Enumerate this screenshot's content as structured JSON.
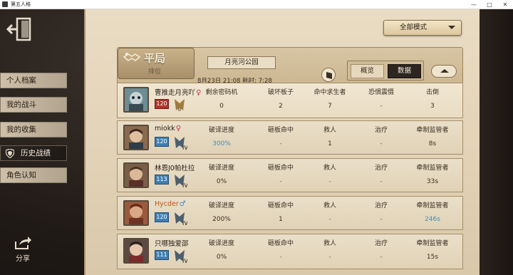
{
  "window": {
    "title": "第五人格",
    "minimize": "—",
    "maximize": "□",
    "close": "✕"
  },
  "sidebar": {
    "items": [
      {
        "label": "个人档案",
        "active": false
      },
      {
        "label": "我的战斗",
        "active": false
      },
      {
        "label": "我的收集",
        "active": false
      },
      {
        "label": "历史战绩",
        "active": true
      },
      {
        "label": "角色认知",
        "active": false
      }
    ],
    "share_label": "分享"
  },
  "mode_select": {
    "value": "全部模式"
  },
  "match": {
    "badge_title": "平局",
    "badge_sub": "排位",
    "map": "月亮河公园",
    "time": "8月23日 21:08 耗时: 7:28",
    "tabs": {
      "overview": "概览",
      "data": "数据"
    }
  },
  "hunter": {
    "name": "曹推走月亮吖",
    "gender": "♀",
    "level": "120",
    "headers": [
      "剩余密码机",
      "破坏板子",
      "命中求生者",
      "恐惧震慑",
      "击倒"
    ],
    "values": [
      "0",
      "2",
      "7",
      "-",
      "3"
    ]
  },
  "survivor_headers": [
    "破译进度",
    "砸板命中",
    "救人",
    "治疗",
    "牵制监管者"
  ],
  "survivors": [
    {
      "name": "miokk",
      "gender": "♀",
      "level": "120",
      "values": [
        "300%",
        "-",
        "1",
        "-",
        "8s"
      ],
      "highlight": [
        true,
        false,
        false,
        false,
        false
      ]
    },
    {
      "name": "林恩J0帕杜拉",
      "gender": "",
      "level": "113",
      "values": [
        "0%",
        "-",
        "-",
        "-",
        "33s"
      ],
      "highlight": [
        false,
        false,
        false,
        false,
        false
      ]
    },
    {
      "name": "Hycder",
      "gender": "♂",
      "level": "120",
      "values": [
        "200%",
        "1",
        "-",
        "-",
        "246s"
      ],
      "highlight": [
        false,
        false,
        false,
        false,
        true
      ]
    },
    {
      "name": "只哪独爱邵",
      "gender": "",
      "level": "111",
      "values": [
        "0%",
        "-",
        "-",
        "-",
        "15s"
      ],
      "highlight": [
        false,
        false,
        false,
        false,
        false
      ]
    }
  ],
  "colors": {
    "paper": "#e3d3b8",
    "female": "#c0395a",
    "male": "#3f8cc2",
    "highlight_value": "#3f8cc2"
  }
}
